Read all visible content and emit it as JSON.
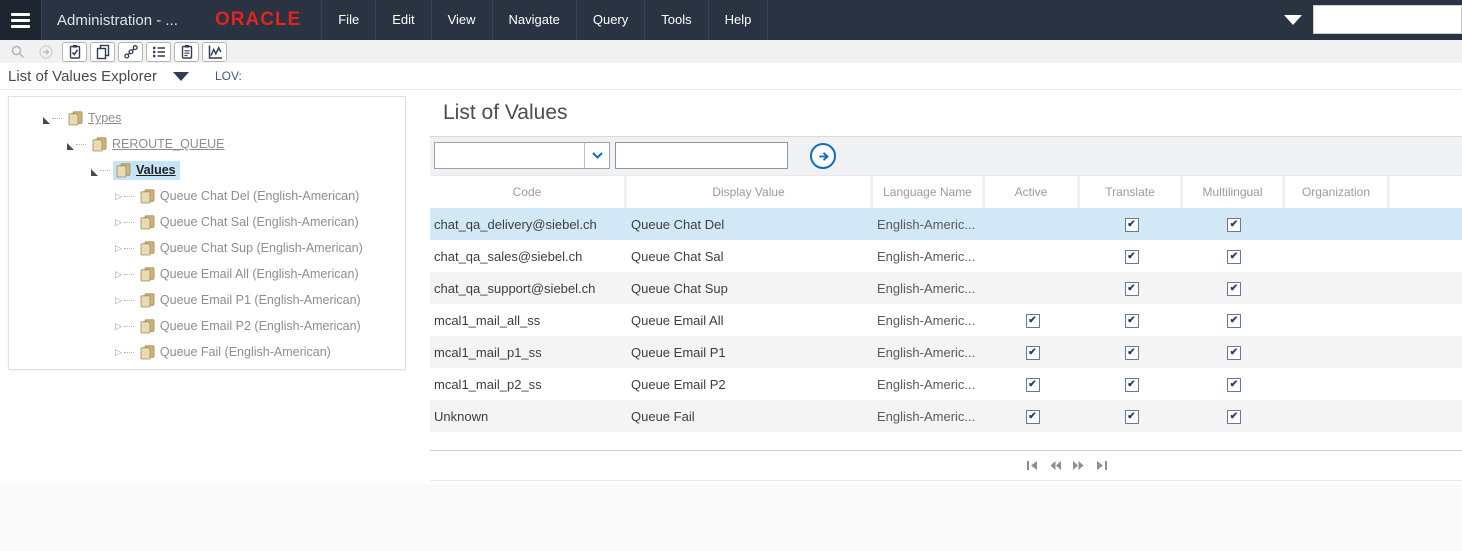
{
  "topbar": {
    "title": "Administration - ...",
    "logo_text": "ORACLE",
    "menus": [
      "File",
      "Edit",
      "View",
      "Navigate",
      "Query",
      "Tools",
      "Help"
    ],
    "search_value": ""
  },
  "toolbar": {
    "buttons": [
      {
        "icon": "search",
        "disabled": true
      },
      {
        "icon": "go",
        "disabled": true
      },
      {
        "icon": "clipboard-check",
        "disabled": false
      },
      {
        "icon": "copy",
        "disabled": false
      },
      {
        "icon": "link",
        "disabled": false
      },
      {
        "icon": "list",
        "disabled": false
      },
      {
        "icon": "clipboard",
        "disabled": false
      },
      {
        "icon": "chart",
        "disabled": false
      }
    ]
  },
  "viewbar": {
    "title": "List of Values Explorer",
    "lov_label": "LOV:"
  },
  "tree": {
    "nodes": [
      {
        "label": "Types",
        "level": 0,
        "expanded": true,
        "link": true,
        "selected": false
      },
      {
        "label": "REROUTE_QUEUE",
        "level": 1,
        "expanded": true,
        "link": true,
        "selected": false
      },
      {
        "label": "Values",
        "level": 2,
        "expanded": true,
        "link": true,
        "selected": true
      },
      {
        "label": "Queue Chat Del (English-American)",
        "level": 3,
        "expanded": false,
        "link": false,
        "selected": false
      },
      {
        "label": "Queue Chat Sal (English-American)",
        "level": 3,
        "expanded": false,
        "link": false,
        "selected": false
      },
      {
        "label": "Queue Chat Sup (English-American)",
        "level": 3,
        "expanded": false,
        "link": false,
        "selected": false
      },
      {
        "label": "Queue Email All (English-American)",
        "level": 3,
        "expanded": false,
        "link": false,
        "selected": false
      },
      {
        "label": "Queue Email P1 (English-American)",
        "level": 3,
        "expanded": false,
        "link": false,
        "selected": false
      },
      {
        "label": "Queue Email P2 (English-American)",
        "level": 3,
        "expanded": false,
        "link": false,
        "selected": false
      },
      {
        "label": "Queue Fail (English-American)",
        "level": 3,
        "expanded": false,
        "link": false,
        "selected": false
      }
    ]
  },
  "panel": {
    "title": "List of Values",
    "filter": {
      "dropdown_value": "",
      "input_value": ""
    },
    "table": {
      "columns": [
        "Code",
        "Display Value",
        "Language Name",
        "Active",
        "Translate",
        "Multilingual",
        "Organization"
      ],
      "rows": [
        {
          "code": "chat_qa_delivery@siebel.ch",
          "display_value": "Queue Chat Del",
          "language_name": "English-Americ...",
          "active": false,
          "translate": true,
          "multilingual": true,
          "organization": "",
          "selected": true
        },
        {
          "code": "chat_qa_sales@siebel.ch",
          "display_value": "Queue Chat Sal",
          "language_name": "English-Americ...",
          "active": false,
          "translate": true,
          "multilingual": true,
          "organization": "",
          "selected": false
        },
        {
          "code": "chat_qa_support@siebel.ch",
          "display_value": "Queue Chat Sup",
          "language_name": "English-Americ...",
          "active": false,
          "translate": true,
          "multilingual": true,
          "organization": "",
          "selected": false
        },
        {
          "code": "mcal1_mail_all_ss",
          "display_value": "Queue Email All",
          "language_name": "English-Americ...",
          "active": true,
          "translate": true,
          "multilingual": true,
          "organization": "",
          "selected": false
        },
        {
          "code": "mcal1_mail_p1_ss",
          "display_value": "Queue Email P1",
          "language_name": "English-Americ...",
          "active": true,
          "translate": true,
          "multilingual": true,
          "organization": "",
          "selected": false
        },
        {
          "code": "mcal1_mail_p2_ss",
          "display_value": "Queue Email P2",
          "language_name": "English-Americ...",
          "active": true,
          "translate": true,
          "multilingual": true,
          "organization": "",
          "selected": false
        },
        {
          "code": "Unknown",
          "display_value": "Queue Fail",
          "language_name": "English-Americ...",
          "active": true,
          "translate": true,
          "multilingual": true,
          "organization": "",
          "selected": false
        }
      ]
    },
    "pagination": [
      {
        "icon": "first"
      },
      {
        "icon": "previous"
      },
      {
        "icon": "next"
      },
      {
        "icon": "last"
      }
    ]
  },
  "colors": {
    "topbar_bg": "#2a3342",
    "hamburger_bg": "#1d2530",
    "oracle_red": "#e2231f",
    "accent_blue": "#0e6cc8",
    "selected_row_bg": "#d2e8f7",
    "alt_row_bg": "#f4f4f4",
    "tree_highlight_bg": "#c6e4f8",
    "icon_navy": "#2f3e57"
  }
}
